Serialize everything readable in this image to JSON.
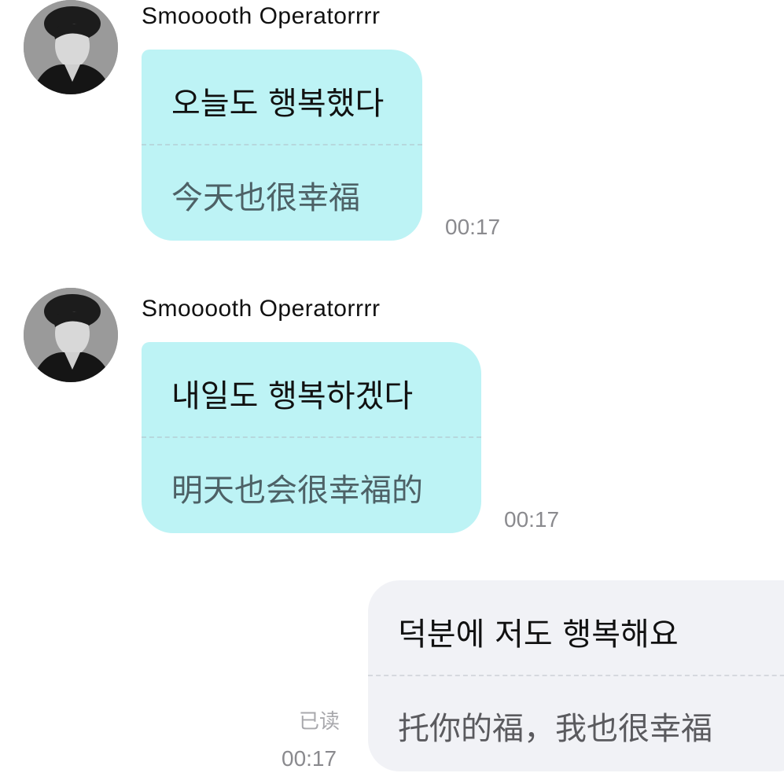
{
  "messages": [
    {
      "sender": "Smooooth Operatorrrr",
      "original": "오늘도 행복했다",
      "translation": "今天也很幸福",
      "time": "00:17"
    },
    {
      "sender": "Smooooth Operatorrrr",
      "original": "내일도 행복하겠다",
      "translation": "明天也会很幸福的",
      "time": "00:17"
    },
    {
      "original": "덕분에 저도 행복해요",
      "translation": "托你的福，我也很幸福",
      "status": "已读",
      "time": "00:17"
    }
  ],
  "colors": {
    "incoming_bubble": "#bdf3f5",
    "outgoing_bubble": "#f1f2f6"
  }
}
